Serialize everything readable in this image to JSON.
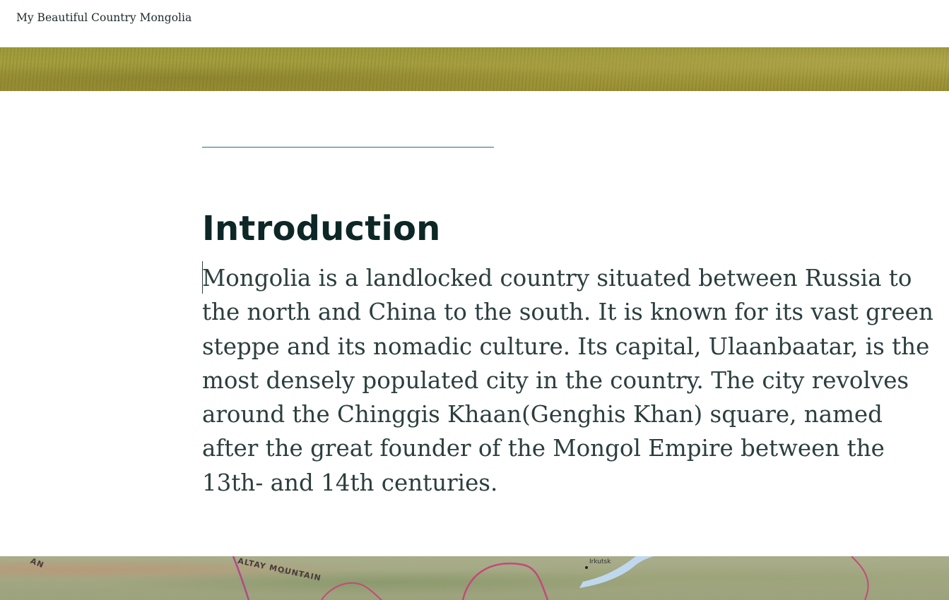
{
  "header": {
    "site_title": "My Beautiful Country Mongolia"
  },
  "article": {
    "heading": "Introduction",
    "body_lines": [
      "Mongolia is a landlocked country situated between Russia to",
      "the north and China to the south. It is known for its vast green",
      "steppe and its nomadic culture. Its capital, Ulaanbaatar, is the",
      "most densely populated city in the country. The city revolves",
      "around the Chinggis Khaan(Genghis Khan) square, named",
      "after the great founder of the Mongol Empire between the",
      "13th- and 14th centuries."
    ]
  },
  "map": {
    "labels": {
      "left_partial": "AN",
      "mountain": "ALTAY MOUNTAIN",
      "city": "Irkutsk"
    }
  },
  "colors": {
    "heading": "#0d2626",
    "body_text": "#2c3e3e",
    "divider": "#2a6f7a",
    "grass": "#a7a03f",
    "lake": "#bfd8ee",
    "border_line": "#c24a7a"
  }
}
